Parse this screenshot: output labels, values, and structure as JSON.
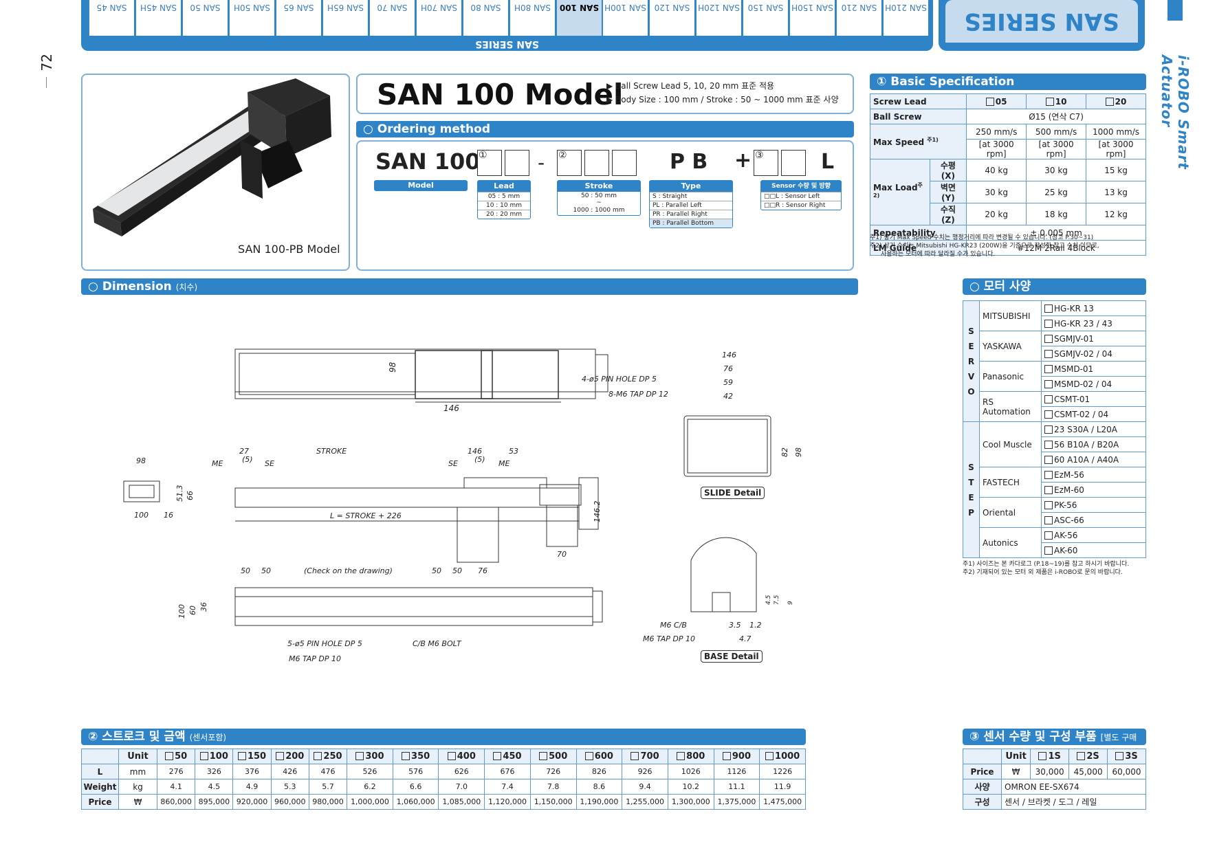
{
  "page_number": "72",
  "brand": "i-ROBO Smart Actuator",
  "series_title": "SAN SERIES",
  "series_tabs_label": "SAN SERIES",
  "tabs": [
    "SAN 210H",
    "SAN 210",
    "SAN 150H",
    "SAN 150",
    "SAN 120H",
    "SAN 120",
    "SAN 100H",
    "SAN 100",
    "SAN 80H",
    "SAN 80",
    "SAN 70H",
    "SAN 70",
    "SAN 65H",
    "SAN 65",
    "SAN 50H",
    "SAN 50",
    "SAN 45H",
    "SAN 45"
  ],
  "active_tab": "SAN 100",
  "product_caption": "SAN 100-PB Model",
  "model_title": "SAN 100 Model",
  "bullets": [
    "▶ Ball Screw Lead 5, 10, 20 mm 표준 적용",
    "▶ Body Size : 100 mm / Stroke : 50 ~ 1000 mm 표준 사양"
  ],
  "ordering": {
    "title": "○ Ordering method",
    "prefix": "SAN 100",
    "num1": "①",
    "num2": "②",
    "num3": "③",
    "dash": "-",
    "pb": "P B",
    "plus": "+",
    "l": "L",
    "model_label": "Model",
    "lead": {
      "header": "Lead",
      "rows": [
        "05 : 5 mm",
        "10 : 10 mm",
        "20 : 20 mm"
      ]
    },
    "stroke": {
      "header": "Stroke",
      "rows": [
        "50 : 50 mm",
        "~",
        "1000 : 1000 mm"
      ]
    },
    "type": {
      "header": "Type",
      "rows": [
        "S : Straight",
        "PL : Parallel Left",
        "PR : Parallel Right",
        "PB : Parallel Bottom"
      ]
    },
    "sensor": {
      "header": "Sensor 수량 및 방향",
      "rows": [
        "□□L : Sensor Left",
        "□□R : Sensor Right"
      ]
    }
  },
  "basic_spec": {
    "title": "① Basic Specification",
    "screw_lead": "Screw Lead",
    "leads": [
      "05",
      "10",
      "20"
    ],
    "ball_screw": "Ball Screw",
    "ball_screw_val": "Ø15 (연삭 C7)",
    "max_speed": "Max Speed",
    "max_speed_note": "주1)",
    "speeds": [
      "250 mm/s",
      "500 mm/s",
      "1000 mm/s"
    ],
    "rpm": "[at 3000 rpm]",
    "max_load": "Max Load",
    "max_load_note": "주2)",
    "load_rows": [
      {
        "axis": "수평 (X)",
        "vals": [
          "40 kg",
          "30 kg",
          "15 kg"
        ]
      },
      {
        "axis": "벽면 (Y)",
        "vals": [
          "30 kg",
          "25 kg",
          "13 kg"
        ]
      },
      {
        "axis": "수직 (Z)",
        "vals": [
          "20 kg",
          "18 kg",
          "12 kg"
        ]
      }
    ],
    "repeatability": "Repeatability",
    "repeatability_val": "± 0.005 mm",
    "lm_guide": "LM Guide",
    "lm_guide_val": "#12M 2Rail 4Block",
    "notes": [
      "주1) 상기 Max Speed 수치는 행정거리에 따라 변경될 수 있습니다. (참고 P.30~31)",
      "주2) 상기 수치는 Mitsubishi HG-KR23 (200W)을 기준으로 작성한 참고 수치 이므로,",
      "사용하는 모터에 따라 달라질 수가 있습니다."
    ]
  },
  "dimension": {
    "title": "○ Dimension",
    "title_small": "(치수)",
    "slide_detail": "SLIDE Detail",
    "base_detail": "BASE Detail",
    "labels": {
      "d146": "146",
      "d76": "76",
      "d59": "59",
      "d42": "42",
      "d82": "82",
      "d98": "98",
      "pin_hole": "4-ø5 PIN HOLE DP 5",
      "tap": "8-M6 TAP DP 12",
      "top98": "98",
      "top146": "146",
      "s27": "27",
      "stroke": "STROKE",
      "s146": "146",
      "s53": "53",
      "me": "ME",
      "se": "SE",
      "p5": "(5)",
      "l_formula": "L = STROKE + 226",
      "e98": "98",
      "e100": "100",
      "e16": "16",
      "e51": "51.3",
      "e66": "66",
      "m146": "146.2",
      "m70": "70",
      "b50a": "50",
      "b50b": "50",
      "bcheck": "(Check on the drawing)",
      "b50c": "50",
      "b50d": "50",
      "b76": "76",
      "b100": "100",
      "b60": "60",
      "b36": "36",
      "pin5": "5-ø5 PIN HOLE DP 5",
      "cb_bolt": "C/B M6 BOLT",
      "m6tap10": "M6 TAP DP 10",
      "m6cb": "M6 C/B",
      "m6tap": "M6 TAP DP 10",
      "d35": "3.5",
      "d12": "1.2",
      "d47": "4.7",
      "d45": "4.5",
      "d75": "7.5",
      "d9": "9"
    }
  },
  "motor": {
    "title": "○ 모터 사양",
    "servo": "SERVO",
    "step": "STEP",
    "groups": [
      {
        "brand": "MITSUBISHI",
        "items": [
          "HG-KR 13",
          "HG-KR 23 / 43"
        ]
      },
      {
        "brand": "YASKAWA",
        "items": [
          "SGMJV-01",
          "SGMJV-02 / 04"
        ]
      },
      {
        "brand": "Panasonic",
        "items": [
          "MSMD-01",
          "MSMD-02 / 04"
        ]
      },
      {
        "brand": "RS Automation",
        "items": [
          "CSMT-01",
          "CSMT-02 / 04"
        ]
      },
      {
        "brand": "Cool Muscle",
        "items": [
          "23 S30A / L20A",
          "56 B10A / B20A",
          "60 A10A / A40A"
        ]
      },
      {
        "brand": "FASTECH",
        "items": [
          "EzM-56",
          "EzM-60"
        ]
      },
      {
        "brand": "Oriental",
        "items": [
          "PK-56",
          "ASC-66"
        ]
      },
      {
        "brand": "Autonics",
        "items": [
          "AK-56",
          "AK-60"
        ]
      }
    ],
    "notes": [
      "주1) 사이즈는 본 카다로그 (P.18~19)를 참고 하시기 바랍니다.",
      "주2) 기재되어 있는 모터 외 제품은 i-ROBO로 문의 바랍니다."
    ]
  },
  "stroke_price": {
    "title": "② 스트로크 및 금액",
    "title_small": "(센서포함)",
    "unit_hdr": "Unit",
    "strokes": [
      "50",
      "100",
      "150",
      "200",
      "250",
      "300",
      "350",
      "400",
      "450",
      "500",
      "600",
      "700",
      "800",
      "900",
      "1000"
    ],
    "rows": [
      {
        "label": "L",
        "unit": "mm",
        "vals": [
          "276",
          "326",
          "376",
          "426",
          "476",
          "526",
          "576",
          "626",
          "676",
          "726",
          "826",
          "926",
          "1026",
          "1126",
          "1226"
        ]
      },
      {
        "label": "Weight",
        "unit": "kg",
        "vals": [
          "4.1",
          "4.5",
          "4.9",
          "5.3",
          "5.7",
          "6.2",
          "6.6",
          "7.0",
          "7.4",
          "7.8",
          "8.6",
          "9.4",
          "10.2",
          "11.1",
          "11.9"
        ]
      },
      {
        "label": "Price",
        "unit": "₩",
        "vals": [
          "860,000",
          "895,000",
          "920,000",
          "960,000",
          "980,000",
          "1,000,000",
          "1,060,000",
          "1,085,000",
          "1,120,000",
          "1,150,000",
          "1,190,000",
          "1,255,000",
          "1,300,000",
          "1,375,000",
          "1,475,000"
        ]
      }
    ]
  },
  "sensor_parts": {
    "title": "③ 센서 수량 및 구성 부품",
    "title_small": "[별도 구매시]",
    "unit_hdr": "Unit",
    "cols": [
      "1S",
      "2S",
      "3S"
    ],
    "price_label": "Price",
    "price_unit": "₩",
    "prices": [
      "30,000",
      "45,000",
      "60,000"
    ],
    "spec_label": "사양",
    "spec_val": "OMRON   EE-SX674",
    "parts_label": "구성",
    "parts_val": "센서 / 브라켓 / 도그 / 레일"
  }
}
